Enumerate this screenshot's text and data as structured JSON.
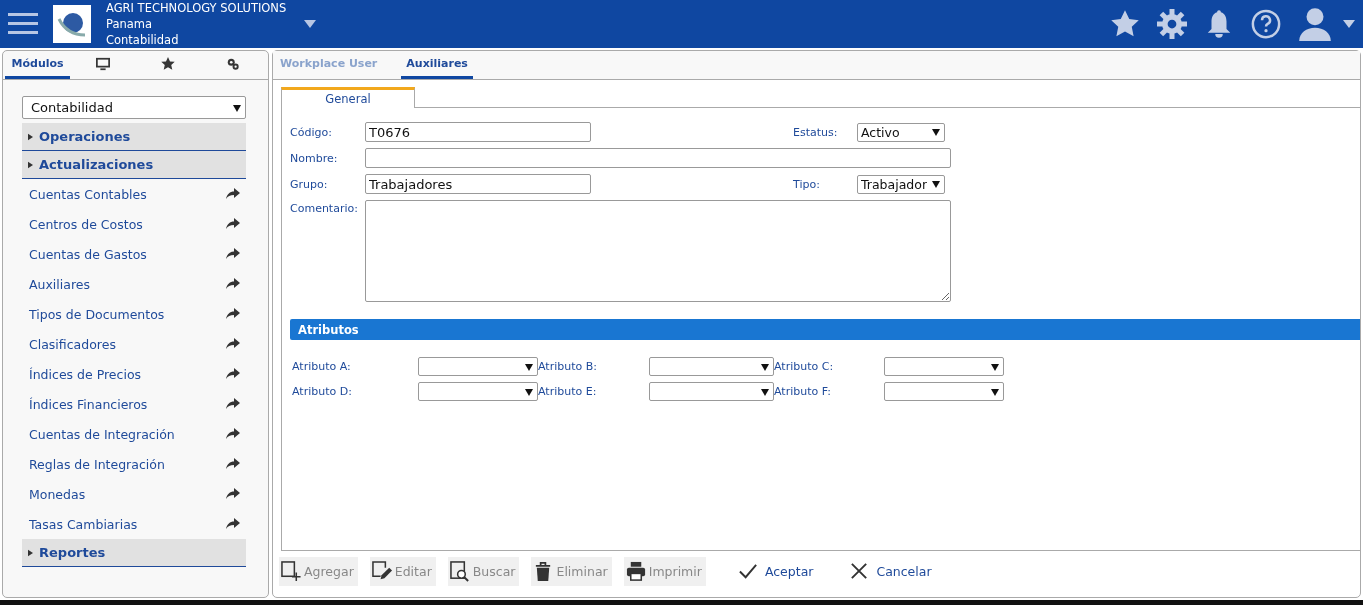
{
  "header": {
    "company": "AGRI TECHNOLOGY SOLUTIONS",
    "country": "Panama",
    "module": "Contabilidad"
  },
  "sidebar": {
    "tabs": [
      {
        "kind": "text",
        "label": "Módulos",
        "selected": true
      },
      {
        "kind": "monitor",
        "selected": false
      },
      {
        "kind": "star",
        "selected": false
      },
      {
        "kind": "gears",
        "selected": false
      }
    ],
    "module_select": "Contabilidad",
    "items": [
      {
        "label": "Operaciones"
      },
      {
        "label": "Actualizaciones",
        "children": [
          {
            "label": "Cuentas Contables"
          },
          {
            "label": "Centros de Costos"
          },
          {
            "label": "Cuentas de Gastos"
          },
          {
            "label": "Auxiliares"
          },
          {
            "label": "Tipos de Documentos"
          },
          {
            "label": "Clasificadores"
          },
          {
            "label": "Índices de Precios"
          },
          {
            "label": "Índices Financieros"
          },
          {
            "label": "Cuentas de Integración"
          },
          {
            "label": "Reglas de Integración"
          },
          {
            "label": "Monedas"
          },
          {
            "label": "Tasas Cambiarias"
          }
        ]
      },
      {
        "label": "Reportes"
      }
    ]
  },
  "tabs": [
    {
      "label": "Workplace User",
      "selected": false
    },
    {
      "label": "Auxiliares",
      "selected": true
    }
  ],
  "subtabs": [
    {
      "label": "General",
      "selected": true
    }
  ],
  "form": {
    "codigo": {
      "label": "Código:",
      "value": "T0676"
    },
    "estatus": {
      "label": "Estatus:",
      "value": "Activo"
    },
    "nombre": {
      "label": "Nombre:"
    },
    "grupo": {
      "label": "Grupo:",
      "value": "Trabajadores"
    },
    "tipo": {
      "label": "Tipo:",
      "value": "Trabajador"
    },
    "comentario": {
      "label": "Comentario:"
    }
  },
  "atributos": {
    "title": "Atributos",
    "fields": [
      {
        "label": "Atributo A:"
      },
      {
        "label": "Atributo B:"
      },
      {
        "label": "Atributo C:"
      },
      {
        "label": "Atributo D:"
      },
      {
        "label": "Atributo E:"
      },
      {
        "label": "Atributo F:"
      }
    ]
  },
  "toolbar": [
    {
      "kind": "add",
      "label": "Agregar",
      "disabled": true
    },
    {
      "kind": "edit",
      "label": "Editar",
      "disabled": true
    },
    {
      "kind": "search",
      "label": "Buscar",
      "disabled": true
    },
    {
      "kind": "trash",
      "label": "Eliminar",
      "disabled": true
    },
    {
      "kind": "print",
      "label": "Imprimir",
      "disabled": true
    },
    {
      "kind": "check",
      "label": "Aceptar",
      "disabled": false
    },
    {
      "kind": "close",
      "label": "Cancelar",
      "disabled": false
    }
  ]
}
